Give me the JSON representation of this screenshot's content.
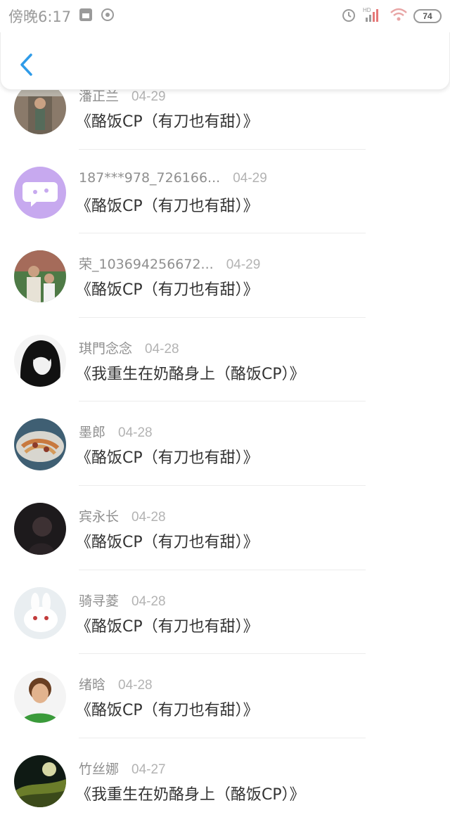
{
  "status_bar": {
    "time": "傍晚6:17",
    "battery": "74",
    "network": "HD"
  },
  "header": {
    "back_icon": "chevron-left-icon",
    "accent": "#2f9be8"
  },
  "comments": [
    {
      "name": "潘正兰",
      "date": "04-29",
      "title": "《酪饭CP（有刀也有甜）》",
      "avatar": "photo-avatar"
    },
    {
      "name": "187***978_726166...",
      "date": "04-29",
      "title": "《酪饭CP（有刀也有甜）》",
      "avatar": "default-chat-avatar"
    },
    {
      "name": "荣_103694256672...",
      "date": "04-29",
      "title": "《酪饭CP（有刀也有甜）》",
      "avatar": "photo-avatar"
    },
    {
      "name": "琪門念念",
      "date": "04-28",
      "title": "《我重生在奶酪身上（酪饭CP）》",
      "avatar": "photo-avatar"
    },
    {
      "name": "墨郎",
      "date": "04-28",
      "title": "《酪饭CP（有刀也有甜）》",
      "avatar": "photo-avatar"
    },
    {
      "name": "宾永长",
      "date": "04-28",
      "title": "《酪饭CP（有刀也有甜）》",
      "avatar": "photo-avatar"
    },
    {
      "name": "骑寻菱",
      "date": "04-28",
      "title": "《酪饭CP（有刀也有甜）》",
      "avatar": "photo-avatar"
    },
    {
      "name": "绪晗",
      "date": "04-28",
      "title": "《酪饭CP（有刀也有甜）》",
      "avatar": "photo-avatar"
    },
    {
      "name": "竹丝娜",
      "date": "04-27",
      "title": "《我重生在奶酪身上（酪饭CP）》",
      "avatar": "photo-avatar"
    }
  ]
}
